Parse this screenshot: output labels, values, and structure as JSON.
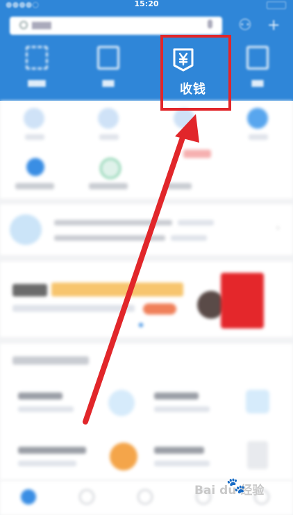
{
  "status_bar": {
    "time": "15:20"
  },
  "header": {
    "tiles": [
      {
        "id": "scan",
        "label": ""
      },
      {
        "id": "pay",
        "label": ""
      },
      {
        "id": "collect",
        "label": "收钱",
        "icon": "yen-receive-icon"
      },
      {
        "id": "card",
        "label": ""
      }
    ]
  },
  "colors": {
    "header_blue": "#2f86d8",
    "highlight_red": "#e1262a"
  },
  "watermark": {
    "text": "Bai du 经验",
    "icon": "baidu-paw-icon"
  }
}
